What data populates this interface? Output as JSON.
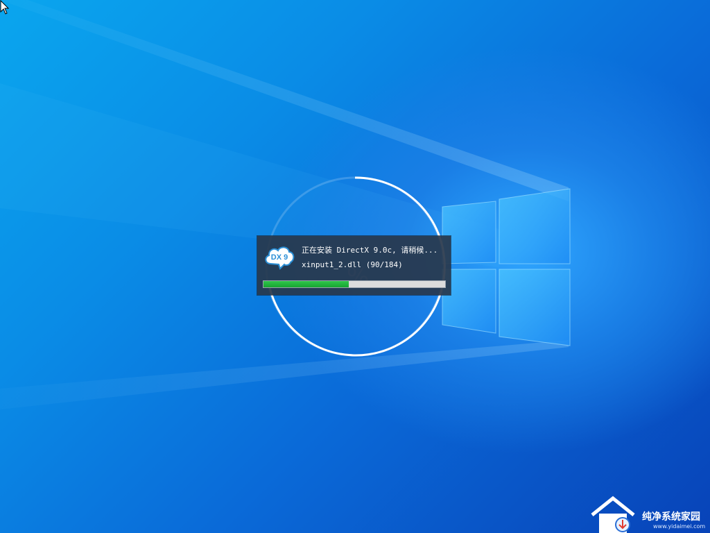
{
  "dialog": {
    "title": "正在安装 DirectX 9.0c, 请稍候...",
    "file": "xinput1_2.dll (90/184)",
    "logo_text": "DX 9",
    "progress": 0.47
  },
  "watermark": {
    "site_name": "纯净系统家园",
    "url": "www.yidaimei.com"
  },
  "icons": {
    "cursor": "mouse-pointer-icon",
    "logo": "directx-cloud-icon",
    "windows": "windows-logo-icon",
    "house": "house-logo-icon"
  },
  "colors": {
    "accent_green": "#1fb33a",
    "dialog_bg": "#28374b",
    "desktop_blue": "#0a7fe0"
  }
}
